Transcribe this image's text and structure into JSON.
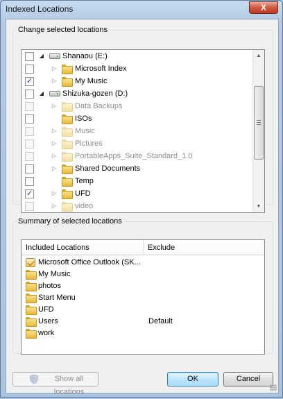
{
  "window": {
    "title": "Indexed Locations",
    "close_glyph": "X"
  },
  "change_group": {
    "legend": "Change selected locations",
    "tree": [
      {
        "label": "Shanaou (E:)",
        "icon": "drive-icon",
        "expander": "expanded",
        "checked": false,
        "dim": false,
        "level": 0
      },
      {
        "label": "Microsoft Index",
        "icon": "folder-icon",
        "expander": "collapsed",
        "checked": false,
        "dim": false,
        "level": 1
      },
      {
        "label": "My Music",
        "icon": "folder-icon",
        "expander": "collapsed",
        "checked": true,
        "dim": false,
        "level": 1
      },
      {
        "label": "Shizuka-gozen (D:)",
        "icon": "drive-icon",
        "expander": "expanded",
        "checked": false,
        "dim": false,
        "level": 0
      },
      {
        "label": "Data Backups",
        "icon": "folder-icon",
        "expander": "collapsed",
        "checked": false,
        "dim": true,
        "level": 1
      },
      {
        "label": "ISOs",
        "icon": "folder-icon",
        "expander": "none",
        "checked": false,
        "dim": false,
        "level": 1
      },
      {
        "label": "Music",
        "icon": "folder-icon",
        "expander": "collapsed",
        "checked": false,
        "dim": true,
        "level": 1
      },
      {
        "label": "Pictures",
        "icon": "folder-icon",
        "expander": "collapsed",
        "checked": false,
        "dim": true,
        "level": 1
      },
      {
        "label": "PortableApps_Suite_Standard_1.0",
        "icon": "folder-icon",
        "expander": "collapsed",
        "checked": false,
        "dim": true,
        "level": 1
      },
      {
        "label": "Shared Documents",
        "icon": "folder-icon",
        "expander": "collapsed",
        "checked": false,
        "dim": false,
        "level": 1
      },
      {
        "label": "Temp",
        "icon": "folder-icon",
        "expander": "none",
        "checked": false,
        "dim": false,
        "level": 1
      },
      {
        "label": "UFD",
        "icon": "folder-icon",
        "expander": "collapsed",
        "checked": true,
        "dim": false,
        "level": 1
      },
      {
        "label": "video",
        "icon": "folder-icon",
        "expander": "collapsed",
        "checked": false,
        "dim": true,
        "level": 1
      }
    ]
  },
  "summary_group": {
    "legend": "Summary of selected locations",
    "columns": {
      "included": "Included Locations",
      "exclude": "Exclude"
    },
    "rows": [
      {
        "name": "Microsoft Office Outlook (SK...",
        "exclude": "",
        "icon": "outlook-icon"
      },
      {
        "name": "My Music",
        "exclude": "",
        "icon": "folder-icon"
      },
      {
        "name": "photos",
        "exclude": "",
        "icon": "folder-icon"
      },
      {
        "name": "Start Menu",
        "exclude": "",
        "icon": "folder-icon"
      },
      {
        "name": "UFD",
        "exclude": "",
        "icon": "folder-icon"
      },
      {
        "name": "Users",
        "exclude": "Default",
        "icon": "folder-icon"
      },
      {
        "name": "work",
        "exclude": "",
        "icon": "folder-icon"
      }
    ]
  },
  "buttons": {
    "show_all": "Show all locations",
    "ok": "OK",
    "cancel": "Cancel"
  },
  "colors": {
    "accent": "#3c7fb1",
    "folder": "#e8b93a",
    "dim_text": "#8d8d8d"
  }
}
